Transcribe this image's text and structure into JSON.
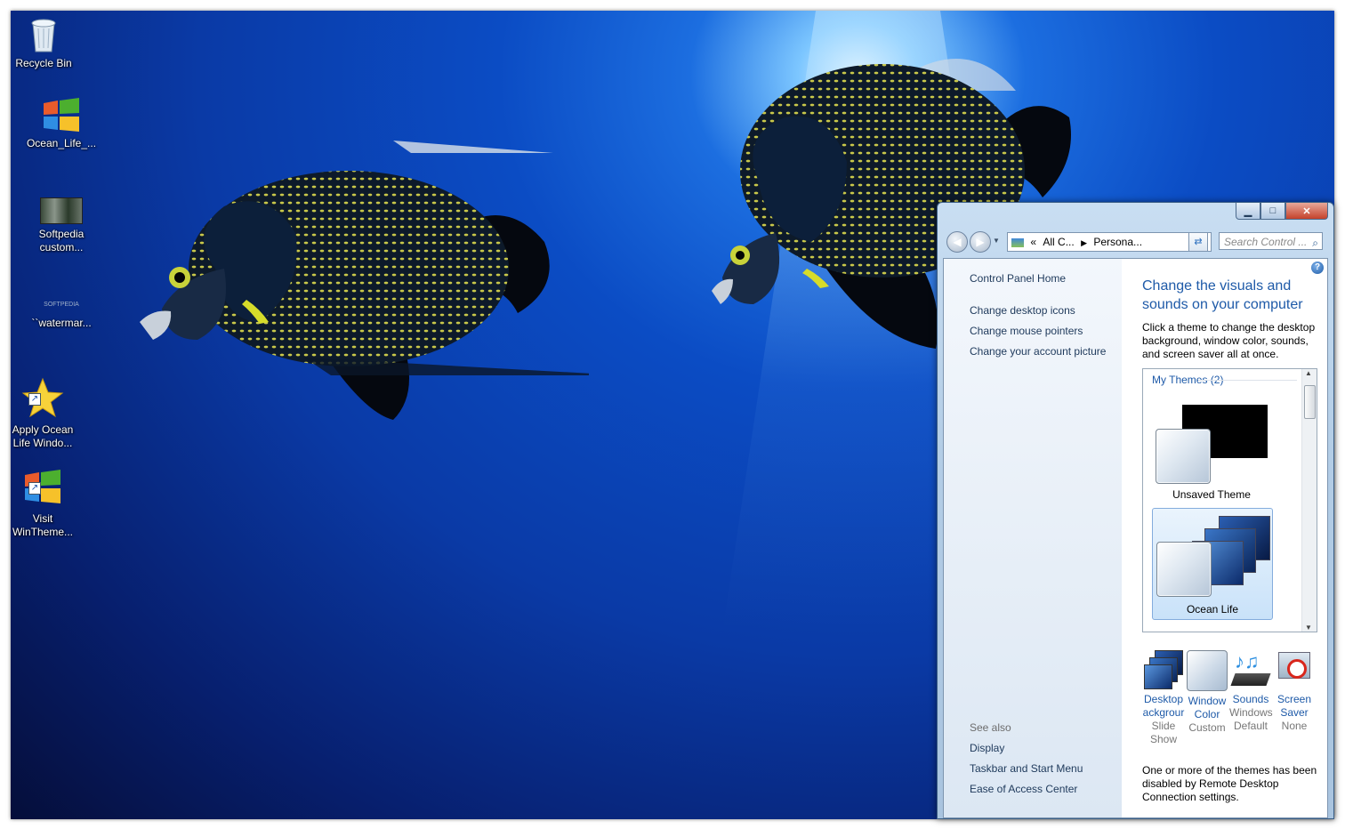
{
  "desktop": {
    "icons": [
      {
        "label": "Recycle Bin",
        "icon": "recycle-bin-icon"
      },
      {
        "label": "Ocean_Life_...",
        "icon": "windows-logo-icon"
      },
      {
        "label": "Softpedia custom...",
        "icon": "forest-image-icon"
      },
      {
        "label": "``watermar...",
        "icon": "watermark-image-icon"
      },
      {
        "label": "Apply Ocean Life Windo...",
        "icon": "star-icon"
      },
      {
        "label": "Visit WinTheme...",
        "icon": "windows-logo-icon"
      }
    ]
  },
  "window": {
    "caption_buttons": {
      "minimize": "minimize-icon",
      "maximize": "maximize-icon",
      "close": "close-icon"
    },
    "address": {
      "part1": "All C...",
      "part2": "Persona..."
    },
    "search_placeholder": "Search Control ...",
    "left_pane": {
      "home": "Control Panel Home",
      "links": [
        "Change desktop icons",
        "Change mouse pointers",
        "Change your account picture"
      ],
      "see_also_label": "See also",
      "see_also": [
        "Display",
        "Taskbar and Start Menu",
        "Ease of Access Center"
      ]
    },
    "main": {
      "heading": "Change the visuals and sounds on your computer",
      "description": "Click a theme to change the desktop background, window color, sounds, and screen saver all at once.",
      "themes_group": "My Themes (2)",
      "themes": [
        {
          "name": "Unsaved Theme"
        },
        {
          "name": "Ocean Life"
        }
      ],
      "bottom": [
        {
          "title_l1": "Desktop",
          "title_l2": "ackgrour",
          "sub_l1": "Slide",
          "sub_l2": "Show",
          "icon": "desktop-background-icon"
        },
        {
          "title_l1": "Window",
          "title_l2": "Color",
          "sub_l1": "Custom",
          "sub_l2": "",
          "icon": "window-color-icon"
        },
        {
          "title_l1": "Sounds",
          "title_l2": "",
          "sub_l1": "Windows",
          "sub_l2": "Default",
          "icon": "sounds-icon"
        },
        {
          "title_l1": "Screen",
          "title_l2": "Saver",
          "sub_l1": "None",
          "sub_l2": "",
          "icon": "screen-saver-icon"
        }
      ],
      "note": "One or more of the themes has been disabled by Remote Desktop Connection settings."
    }
  }
}
